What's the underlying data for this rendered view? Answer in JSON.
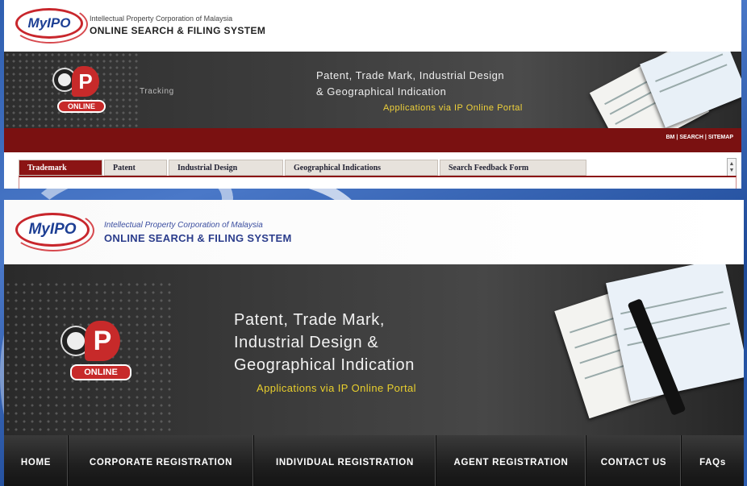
{
  "top": {
    "header": {
      "logo_text": "MyIPO",
      "subtitle": "Intellectual Property Corporation of Malaysia",
      "title": "ONLINE SEARCH & FILING SYSTEM"
    },
    "banner": {
      "online_label": "ONLINE",
      "tracking": "Tracking",
      "line1": "Patent, Trade Mark, Industrial Design",
      "line2": "& Geographical Indication",
      "line3": "Applications  via IP Online Portal"
    },
    "top_links": [
      "BM",
      "SEARCH",
      "SITEMAP"
    ],
    "tabs": [
      {
        "label": "Trademark",
        "active": true
      },
      {
        "label": "Patent",
        "active": false
      },
      {
        "label": "Industrial Design",
        "active": false
      },
      {
        "label": "Geographical Indications",
        "active": false
      },
      {
        "label": "Search Feedback Form",
        "active": false
      }
    ]
  },
  "bottom": {
    "header": {
      "logo_text": "MyIPO",
      "subtitle": "Intellectual Property Corporation of Malaysia",
      "title": "ONLINE SEARCH & FILING SYSTEM"
    },
    "banner": {
      "online_label": "ONLINE",
      "line1": "Patent, Trade Mark,",
      "line2": "Industrial Design &",
      "line3": "Geographical Indication",
      "line4": "Applications  via IP Online Portal"
    },
    "nav": [
      "HOME",
      "CORPORATE REGISTRATION",
      "INDIVIDUAL REGISTRATION",
      "AGENT REGISTRATION",
      "CONTACT US",
      "FAQs"
    ]
  },
  "colors": {
    "brand_red": "#8b1414",
    "brand_blue": "#1d3f94",
    "accent_yellow": "#f0d23a",
    "background_blue": "#2f5fb0"
  }
}
